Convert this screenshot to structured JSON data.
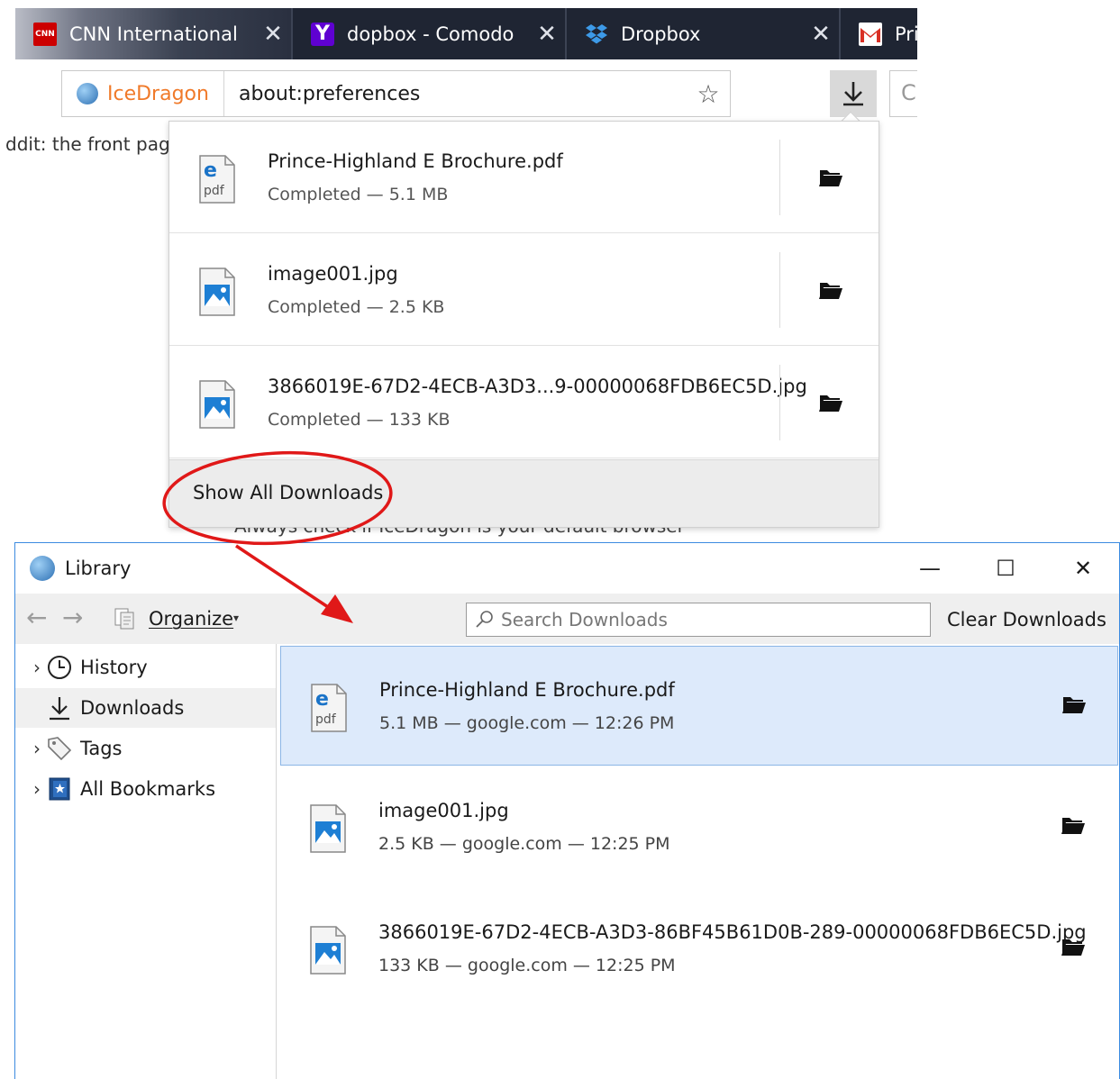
{
  "browser": {
    "tabs": [
      {
        "title": "CNN International",
        "icon": "cnn-favicon",
        "favicon_text": "CNN"
      },
      {
        "title": "dopbox - Comodo",
        "icon": "yahoo-favicon",
        "favicon_text": "Y"
      },
      {
        "title": "Dropbox",
        "icon": "dropbox-favicon"
      },
      {
        "title": "Pri",
        "icon": "gmail-favicon"
      }
    ],
    "tab_close_glyph": "✕",
    "identity_label": "IceDragon",
    "url": "about:preferences",
    "search_stub_char": "C",
    "background_text": "ddit: the front pag",
    "background_line": "Always check if IceDragon is your default browser"
  },
  "downloads_panel": {
    "items": [
      {
        "name": "Prince-Highland E Brochure.pdf",
        "status": "Completed — 5.1 MB",
        "type": "pdf"
      },
      {
        "name": "image001.jpg",
        "status": "Completed — 2.5 KB",
        "type": "image"
      },
      {
        "name": "3866019E-67D2-4ECB-A3D3...9-00000068FDB6EC5D.jpg",
        "status": "Completed — 133 KB",
        "type": "image"
      }
    ],
    "show_all_label": "Show All Downloads"
  },
  "library": {
    "title": "Library",
    "window_buttons": {
      "minimize": "—",
      "maximize": "☐",
      "close": "✕"
    },
    "toolbar": {
      "back": "←",
      "forward": "→",
      "organize_label": "Organize",
      "organize_caret": "▾",
      "search_placeholder": "Search Downloads",
      "clear_label": "Clear Downloads"
    },
    "sidebar": [
      {
        "label": "History",
        "twisty": "›",
        "icon": "history-clock-icon"
      },
      {
        "label": "Downloads",
        "twisty": "",
        "icon": "download-arrow-icon",
        "selected": true
      },
      {
        "label": "Tags",
        "twisty": "›",
        "icon": "tag-icon"
      },
      {
        "label": "All Bookmarks",
        "twisty": "›",
        "icon": "bookmarks-book-icon"
      }
    ],
    "items": [
      {
        "name": "Prince-Highland E Brochure.pdf",
        "status": "5.1 MB — google.com — 12:26 PM",
        "type": "pdf",
        "selected": true
      },
      {
        "name": "image001.jpg",
        "status": "2.5 KB — google.com — 12:25 PM",
        "type": "image"
      },
      {
        "name": "3866019E-67D2-4ECB-A3D3-86BF45B61D0B-289-00000068FDB6EC5D.jpg",
        "status": "133 KB — google.com — 12:25 PM",
        "type": "image"
      }
    ]
  },
  "colors": {
    "tabstrip": "#1f2533",
    "identity": "#f07a2a",
    "annotation": "#e01818",
    "selection": "#ddeafb",
    "window_border": "#3c8be0"
  }
}
